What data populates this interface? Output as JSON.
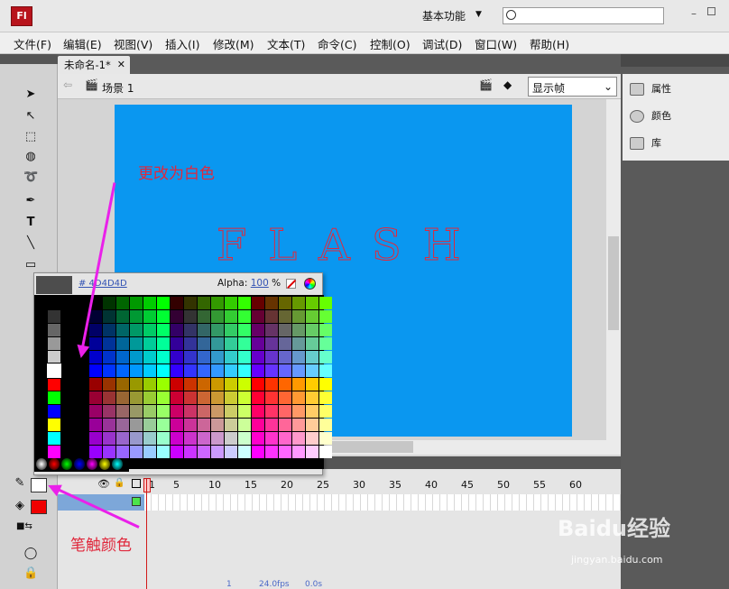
{
  "app": {
    "logo": "Fl",
    "workspace": "基本功能"
  },
  "menu": [
    "文件(F)",
    "编辑(E)",
    "视图(V)",
    "插入(I)",
    "修改(M)",
    "文本(T)",
    "命令(C)",
    "控制(O)",
    "调试(D)",
    "窗口(W)",
    "帮助(H)"
  ],
  "document": {
    "tab": "未命名-1*",
    "scene": "场景 1",
    "zoom_select": "显示帧"
  },
  "stage": {
    "text": "FLASH",
    "bg": "#0a97f0",
    "text_color": "#e0283c"
  },
  "annotations": {
    "top": "更改为白色",
    "bottom": "笔触颜色"
  },
  "picker": {
    "hex": "# 4D4D4D",
    "alpha_label": "Alpha:",
    "alpha_value": "100",
    "alpha_unit": "%"
  },
  "timeline": {
    "frames": [
      "1",
      "5",
      "10",
      "15",
      "20",
      "25",
      "30",
      "35",
      "40",
      "45",
      "50",
      "55",
      "60"
    ],
    "status": [
      "1",
      "24.0fps",
      "0.0s"
    ]
  },
  "right_panel": [
    "属性",
    "颜色",
    "库"
  ],
  "colors": {
    "stroke": "#ffffff",
    "fill": "#ef0000"
  },
  "watermark": {
    "brand": "Baidu经验",
    "url": "jingyan.baidu.com"
  }
}
